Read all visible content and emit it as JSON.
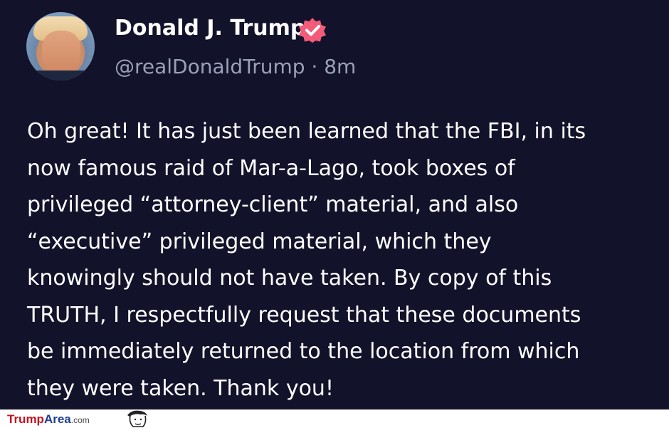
{
  "post": {
    "author": {
      "display_name": "Donald J. Trump",
      "handle": "@realDonaldTrump",
      "separator": " · ",
      "time": "8m",
      "verified_icon": "verified-badge-icon"
    },
    "text_lines": [
      "Oh great! It has just been learned that the FBI, in its",
      "now famous raid of Mar-a-Lago, took boxes of",
      "privileged “attorney-client” material, and also",
      "“executive” privileged material, which they",
      "knowingly should not have taken. By copy of this",
      "TRUTH, I respectfully request that these documents",
      "be immediately returned to the location from which",
      "they were taken. Thank you!"
    ]
  },
  "watermark": {
    "part1": "Trump",
    "part2": "Area",
    "part3": ".com"
  },
  "colors": {
    "background": "#12122b",
    "verified": "#f25c78",
    "handle": "#9aa0b8"
  }
}
